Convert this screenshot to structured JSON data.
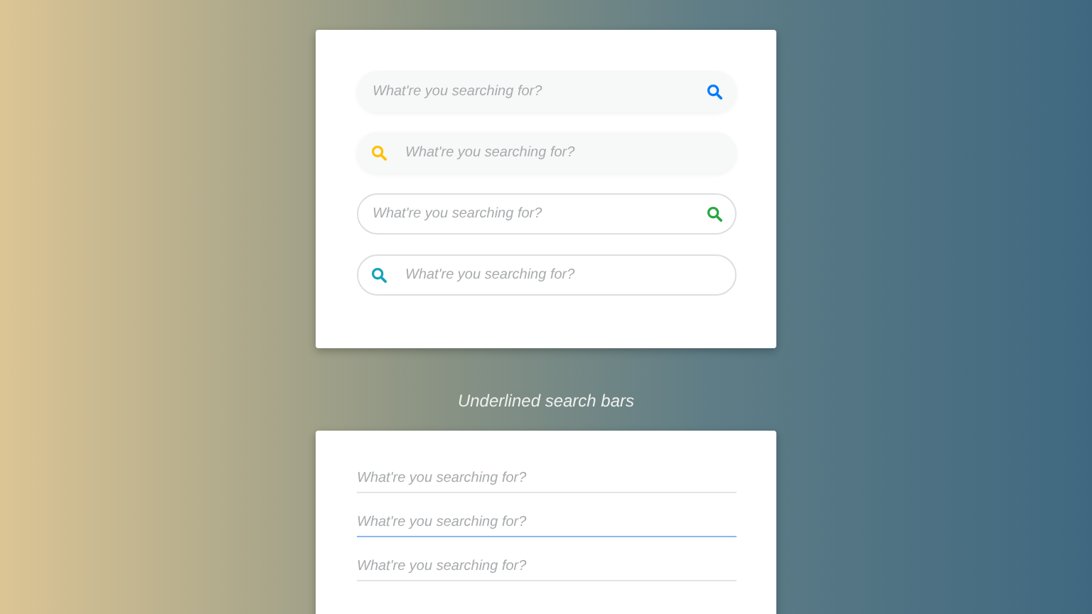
{
  "rounded_search_bars": [
    {
      "kind": "filled",
      "placeholder": "What're you searching for?",
      "icon_left": false,
      "color": "#007bff"
    },
    {
      "kind": "filled",
      "placeholder": "What're you searching for?",
      "icon_left": true,
      "color": "#ffc107"
    },
    {
      "kind": "outlined",
      "placeholder": "What're you searching for?",
      "icon_left": false,
      "color": "#28a745"
    },
    {
      "kind": "outlined",
      "placeholder": "What're you searching for?",
      "icon_left": true,
      "color": "#17a2b8"
    }
  ],
  "section_title": "Underlined search bars",
  "underlined_search_bars": [
    {
      "placeholder": "What're you searching for?",
      "selected": false
    },
    {
      "placeholder": "What're you searching for?",
      "selected": true
    },
    {
      "placeholder": "What're you searching for?",
      "selected": false
    }
  ]
}
